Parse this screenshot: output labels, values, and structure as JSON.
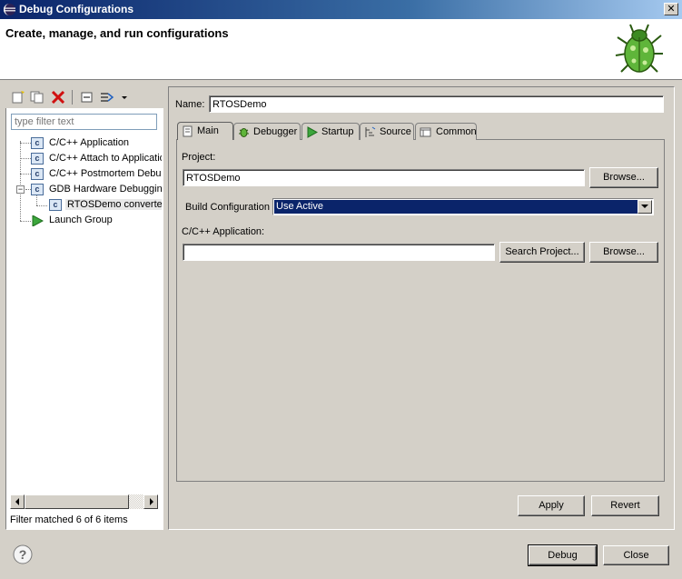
{
  "window": {
    "title": "Debug Configurations",
    "close_glyph": "✕"
  },
  "banner": {
    "title": "Create, manage, and run configurations",
    "icon": "bug-icon"
  },
  "left": {
    "toolbar": [
      {
        "name": "new-config-icon"
      },
      {
        "name": "duplicate-icon"
      },
      {
        "name": "delete-icon"
      },
      {
        "name": "collapse-all-icon"
      },
      {
        "name": "filter-icon"
      },
      {
        "name": "menu-chevron-icon"
      }
    ],
    "filter_placeholder": "type filter text",
    "tree": [
      {
        "label": "C/C++ Application"
      },
      {
        "label": "C/C++ Attach to Application"
      },
      {
        "label": "C/C++ Postmortem Debugger"
      },
      {
        "label": "GDB Hardware Debugging",
        "expander": "−"
      },
      {
        "label": "RTOSDemo converted"
      },
      {
        "label": "Launch Group"
      }
    ],
    "status": "Filter matched 6 of 6 items"
  },
  "right": {
    "name_label": "Name:",
    "name_value": "RTOSDemo",
    "tabs": [
      {
        "label": "Main"
      },
      {
        "label": "Debugger"
      },
      {
        "label": "Startup"
      },
      {
        "label": "Source"
      },
      {
        "label": "Common"
      }
    ],
    "project_label": "Project:",
    "project_value": "RTOSDemo",
    "browse1": "Browse...",
    "build_config_label": "Build Configuration",
    "build_config_value": "Use Active",
    "app_label": "C/C++ Application:",
    "app_value": "",
    "search_project": "Search Project...",
    "browse2": "Browse...",
    "apply": "Apply",
    "revert": "Revert"
  },
  "footer": {
    "help_glyph": "?",
    "debug": "Debug",
    "close": "Close"
  }
}
